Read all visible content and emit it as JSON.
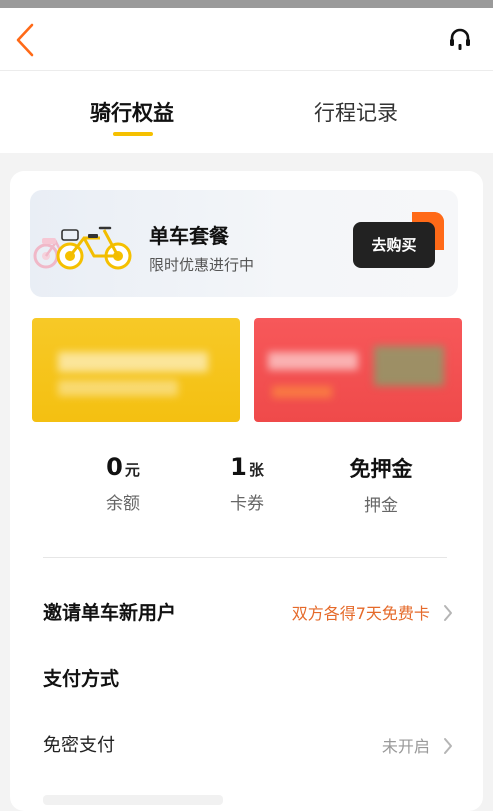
{
  "header": {
    "back_icon": "chevron-left-icon",
    "service_icon": "headset-icon",
    "accent_color": "#ff6a18"
  },
  "tabs": [
    {
      "label": "骑行权益",
      "active": true
    },
    {
      "label": "行程记录",
      "active": false
    }
  ],
  "tab_indicator_color": "#f5c000",
  "promo": {
    "title": "单车套餐",
    "subtitle": "限时优惠进行中",
    "buy_label": "去购买"
  },
  "banners": {
    "left_color": "#f5c414",
    "right_color": "#f05252"
  },
  "stats": [
    {
      "value": "0",
      "unit": "元",
      "label": "余额"
    },
    {
      "value": "1",
      "unit": "张",
      "label": "卡券"
    },
    {
      "value": "免押金",
      "unit": "",
      "label": "押金"
    }
  ],
  "invite": {
    "title": "邀请单车新用户",
    "right_text": "双方各得7天免费卡"
  },
  "payment": {
    "section_title": "支付方式",
    "password_free": {
      "label": "免密支付",
      "status": "未开启"
    }
  }
}
